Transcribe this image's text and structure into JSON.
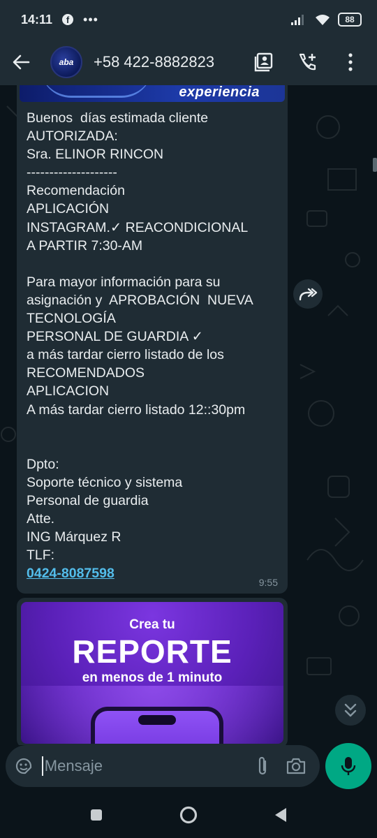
{
  "status_bar": {
    "time": "14:11",
    "notification_icon": "facebook-icon",
    "more": "•••",
    "battery": "88"
  },
  "header": {
    "contact_name": "+58 422-8882823",
    "avatar_text": "aba",
    "icons": [
      "back-arrow-icon",
      "contact-card-icon",
      "add-call-icon",
      "more-vert-icon"
    ]
  },
  "message": {
    "banner_text": "experiencia",
    "text": "Buenos  días estimada cliente\nAUTORIZADA:\nSra. ELINOR RINCON\n--------------------\nRecomendación\nAPLICACIÓN\nINSTAGRAM.✓ REACONDICIONAL\nA PARTIR 7:30-AM\n\nPara mayor información para su asignación y  APROBACIÓN  NUEVA TECNOLOGÍA\nPERSONAL DE GUARDIA ✓\na más tardar cierro listado de los RECOMENDADOS\nAPLICACION\nA más tardar cierro listado 12::30pm\n\n\nDpto:\nSoporte técnico y sistema\nPersonal de guardia\nAtte.\nING Márquez R\nTLF:",
    "phone_link": "0424-8087598",
    "time": "9:55"
  },
  "promo": {
    "line1": "Crea tu",
    "line2": "REPORTE",
    "line3": "en menos de 1 minuto"
  },
  "input": {
    "placeholder": "Mensaje"
  },
  "colors": {
    "bubble": "#1f2c34",
    "background": "#0b141a",
    "accent": "#00a884",
    "link": "#53bdeb"
  }
}
